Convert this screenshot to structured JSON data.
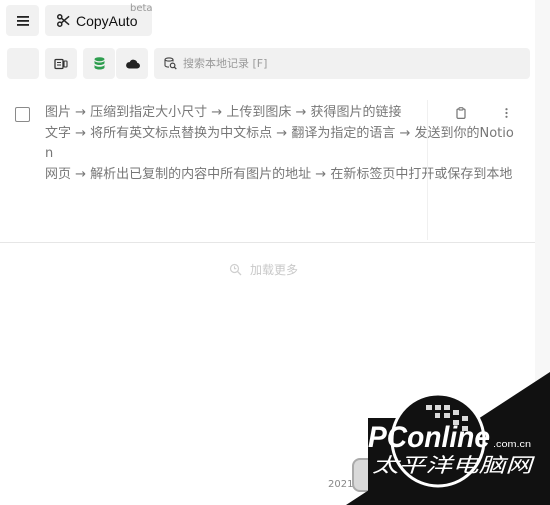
{
  "app": {
    "title": "CopyAuto",
    "beta": "beta"
  },
  "icons": {
    "menu": "hamburger-menu-icon",
    "app": "scissors-icon",
    "clipboard": "clipboard-device-icon",
    "database": "database-icon",
    "cloud": "cloud-icon",
    "search": "search-database-icon",
    "copy": "clipboard-copy-icon",
    "more": "vertical-dots-icon",
    "loading": "loading-icon"
  },
  "colors": {
    "database_icon": "#2e9e4f",
    "toolbar_bg": "#f1f1f1",
    "watermark": "#111111"
  },
  "search": {
    "placeholder": "搜索本地记录 [F]"
  },
  "records": [
    {
      "text": "图片 → 压缩到指定大小尺寸 → 上传到图床 → 获得图片的链接\n文字 → 将所有英文标点替换为中文标点 → 翻译为指定的语言 → 发送到你的Notion\n网页 → 解析出已复制的内容中所有图片的地址 → 在新标签页中打开或保存到本地"
    }
  ],
  "load_more": "加载更多",
  "footer": {
    "year": "2021"
  },
  "watermark": {
    "brand": "PConline",
    "domain": ".com.cn",
    "cn": "太平洋电脑网"
  }
}
